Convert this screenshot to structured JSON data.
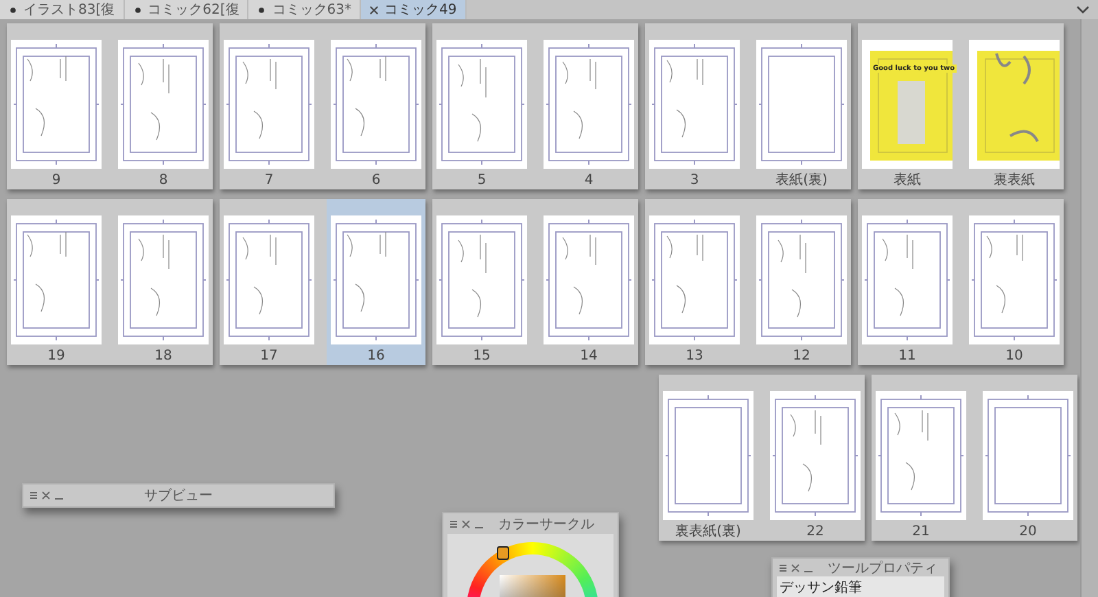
{
  "tabs": [
    {
      "label": "イラスト83[復",
      "selected": false
    },
    {
      "label": "コミック62[復",
      "selected": false
    },
    {
      "label": "コミック63*",
      "selected": false
    },
    {
      "label": "コミック49",
      "selected": true
    }
  ],
  "rows": [
    {
      "spreads": [
        {
          "pages": [
            {
              "label": "9",
              "selected": false,
              "kind": "sketch"
            },
            {
              "label": "8",
              "selected": false,
              "kind": "sketch"
            }
          ]
        },
        {
          "pages": [
            {
              "label": "7",
              "selected": false,
              "kind": "sketch"
            },
            {
              "label": "6",
              "selected": false,
              "kind": "sketch"
            }
          ]
        },
        {
          "pages": [
            {
              "label": "5",
              "selected": false,
              "kind": "sketch"
            },
            {
              "label": "4",
              "selected": false,
              "kind": "sketch"
            }
          ]
        },
        {
          "pages": [
            {
              "label": "3",
              "selected": false,
              "kind": "sketch"
            },
            {
              "label": "表紙(裏)",
              "selected": false,
              "kind": "blank"
            }
          ]
        },
        {
          "pages": [
            {
              "label": "表紙",
              "selected": false,
              "kind": "cover",
              "cover_text": "Good luck to you two"
            },
            {
              "label": "裏表紙",
              "selected": false,
              "kind": "cover"
            }
          ]
        }
      ]
    },
    {
      "spreads": [
        {
          "pages": [
            {
              "label": "19",
              "selected": false,
              "kind": "sketch"
            },
            {
              "label": "18",
              "selected": false,
              "kind": "sketch"
            }
          ]
        },
        {
          "pages": [
            {
              "label": "17",
              "selected": false,
              "kind": "sketch"
            },
            {
              "label": "16",
              "selected": true,
              "kind": "sketch"
            }
          ]
        },
        {
          "pages": [
            {
              "label": "15",
              "selected": false,
              "kind": "sketch"
            },
            {
              "label": "14",
              "selected": false,
              "kind": "sketch"
            }
          ]
        },
        {
          "pages": [
            {
              "label": "13",
              "selected": false,
              "kind": "sketch"
            },
            {
              "label": "12",
              "selected": false,
              "kind": "sketch"
            }
          ]
        },
        {
          "pages": [
            {
              "label": "11",
              "selected": false,
              "kind": "sketch"
            },
            {
              "label": "10",
              "selected": false,
              "kind": "sketch"
            }
          ]
        }
      ]
    },
    {
      "spreads": [
        {
          "pages": [
            {
              "label": "裏表紙(裏)",
              "selected": false,
              "kind": "blank"
            },
            {
              "label": "22",
              "selected": false,
              "kind": "sketch"
            }
          ]
        },
        {
          "pages": [
            {
              "label": "21",
              "selected": false,
              "kind": "sketch"
            },
            {
              "label": "20",
              "selected": false,
              "kind": "blank"
            }
          ]
        }
      ]
    }
  ],
  "sub_view": {
    "title": "サブビュー"
  },
  "color_circle": {
    "title": "カラーサークル"
  },
  "tool_property": {
    "title": "ツールプロパティ",
    "tool": "デッサン鉛筆"
  }
}
